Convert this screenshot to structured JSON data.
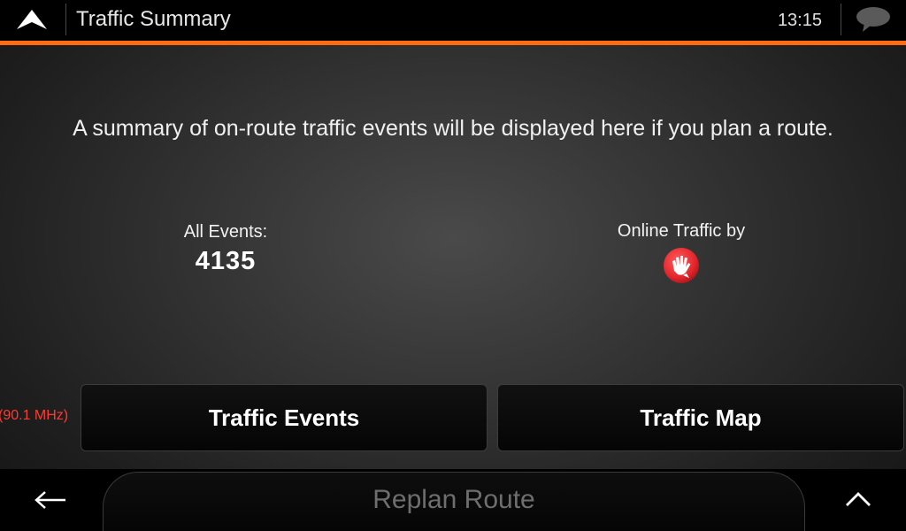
{
  "header": {
    "title": "Traffic Summary",
    "time": "13:15"
  },
  "main": {
    "info": "A summary of on-route traffic events will be displayed here if you plan a route.",
    "events_label": "All Events:",
    "events_count": "4135",
    "provider_label": "Online Traffic by",
    "radio_frequency": "(90.1 MHz)"
  },
  "actions": {
    "traffic_events_label": "Traffic Events",
    "traffic_map_label": "Traffic Map"
  },
  "bottom": {
    "replan_label": "Replan Route"
  },
  "icons": {
    "nav": "navigation-arrow-icon",
    "message": "speech-bubble-icon",
    "provider_logo": "tomtom-hand-logo-icon",
    "back": "arrow-left-icon",
    "up": "chevron-up-icon"
  },
  "colors": {
    "accent": "#ff6a13",
    "radio_text": "#ff3b30",
    "logo_red": "#e3262c"
  }
}
